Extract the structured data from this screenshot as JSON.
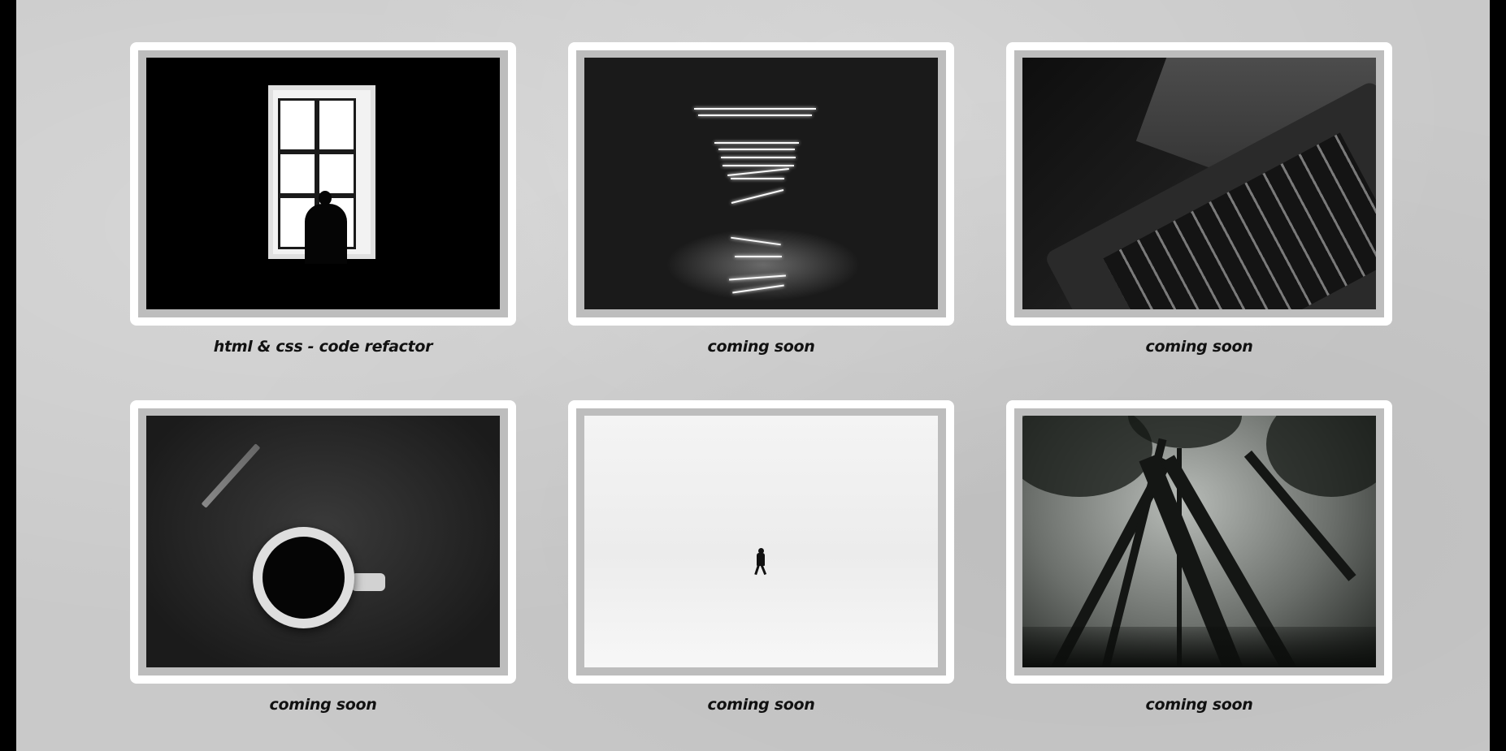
{
  "gallery": {
    "items": [
      {
        "caption": "html & css - code refactor",
        "image": "window-silhouette"
      },
      {
        "caption": "coming soon",
        "image": "light-tunnel"
      },
      {
        "caption": "coming soon",
        "image": "laptop-keyboard"
      },
      {
        "caption": "coming soon",
        "image": "coffee-and-pencil"
      },
      {
        "caption": "coming soon",
        "image": "person-walking-in-snow"
      },
      {
        "caption": "coming soon",
        "image": "foggy-forest"
      }
    ]
  }
}
